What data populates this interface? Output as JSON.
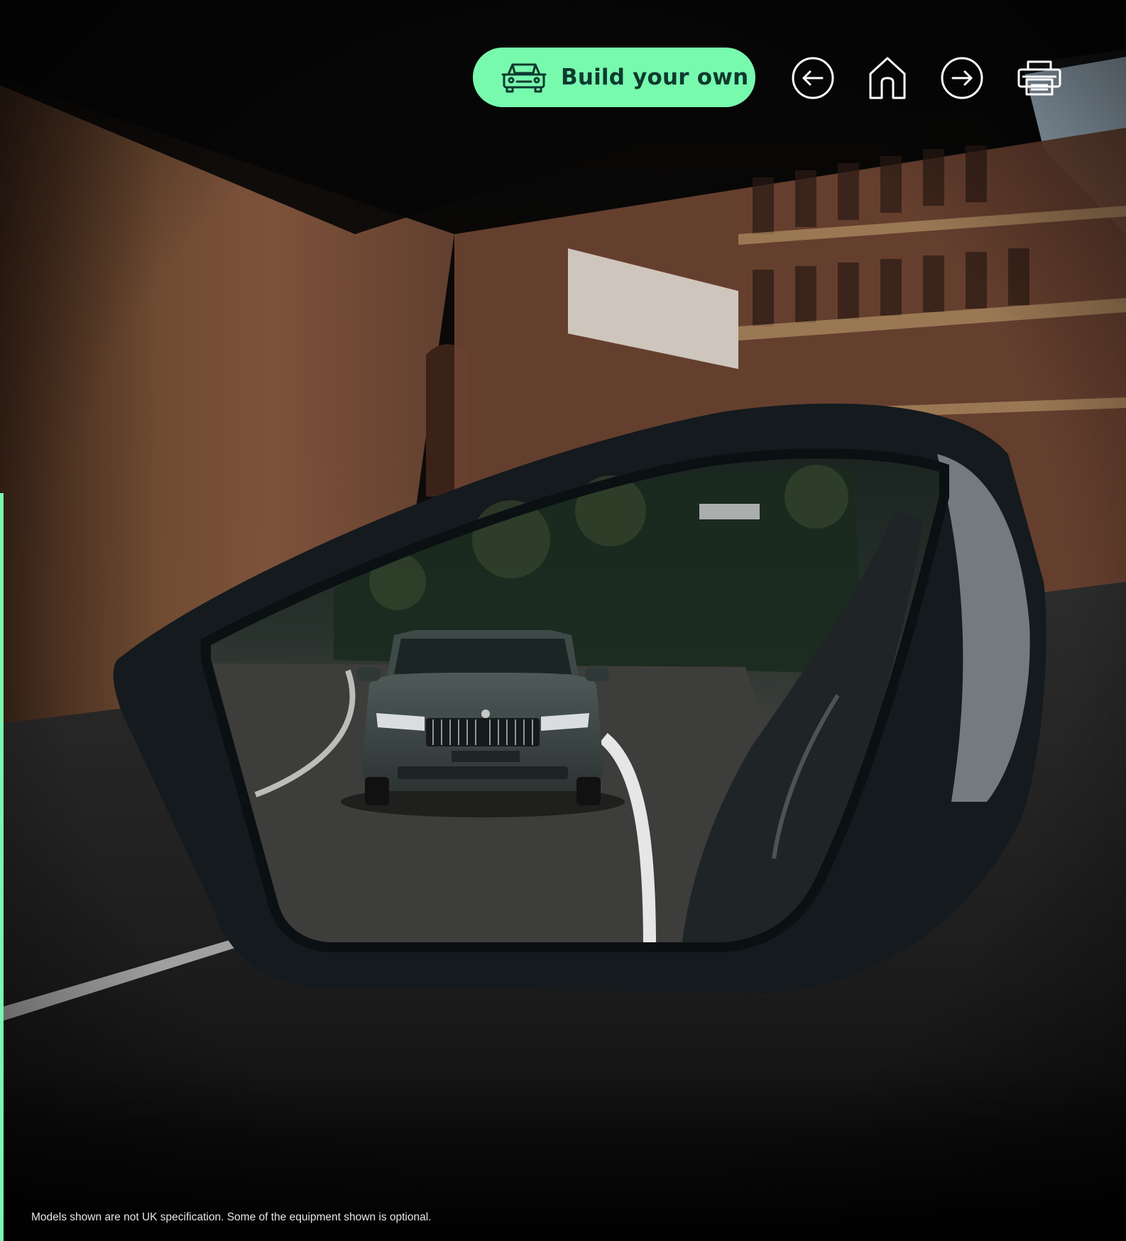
{
  "toolbar": {
    "build_label": "Build your own",
    "build_icon": "car-front-icon",
    "nav": [
      {
        "name": "back-arrow-icon"
      },
      {
        "name": "home-icon"
      },
      {
        "name": "forward-arrow-icon"
      },
      {
        "name": "print-icon"
      }
    ]
  },
  "colors": {
    "accent": "#78FAAE",
    "accent_text": "#0E3A2F"
  },
  "footnote": "Models shown are not UK specification. Some of the equipment shown is optional."
}
